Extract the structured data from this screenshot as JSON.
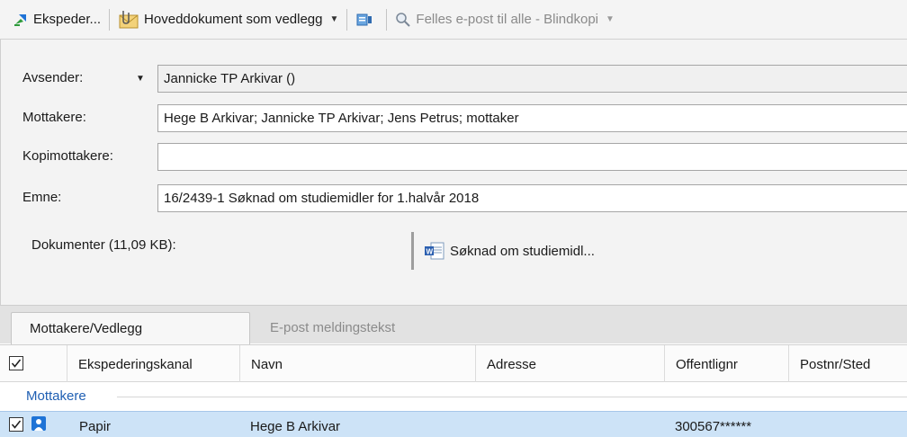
{
  "toolbar": {
    "send_label": "Ekspeder...",
    "main_doc_label": "Hoveddokument som vedlegg",
    "common_email_label": "Felles e-post til alle - Blindkopi"
  },
  "form": {
    "sender_label": "Avsender:",
    "sender_value": "Jannicke TP Arkivar ()",
    "recipients_label": "Mottakere:",
    "recipients_value": "Hege B Arkivar; Jannicke TP Arkivar; Jens Petrus; mottaker",
    "cc_label": "Kopimottakere:",
    "cc_value": "",
    "subject_label": "Emne:",
    "subject_value": "16/2439-1 Søknad om studiemidler for 1.halvår 2018",
    "documents_label": "Dokumenter (11,09 KB):",
    "document_name": "Søknad om studiemidl..."
  },
  "tabs": [
    {
      "label": "Mottakere/Vedlegg",
      "active": true
    },
    {
      "label": "E-post meldingstekst",
      "active": false
    }
  ],
  "grid": {
    "columns": [
      "Ekspederingskanal",
      "Navn",
      "Adresse",
      "Offentlignr",
      "Postnr/Sted"
    ],
    "group_label": "Mottakere",
    "rows": [
      {
        "checked": true,
        "channel": "Papir",
        "name": "Hege B Arkivar",
        "address": "",
        "public_no": "300567******",
        "postal": ""
      }
    ]
  },
  "colors": {
    "accent": "#1f5fb3",
    "selection": "#cde3f7"
  }
}
